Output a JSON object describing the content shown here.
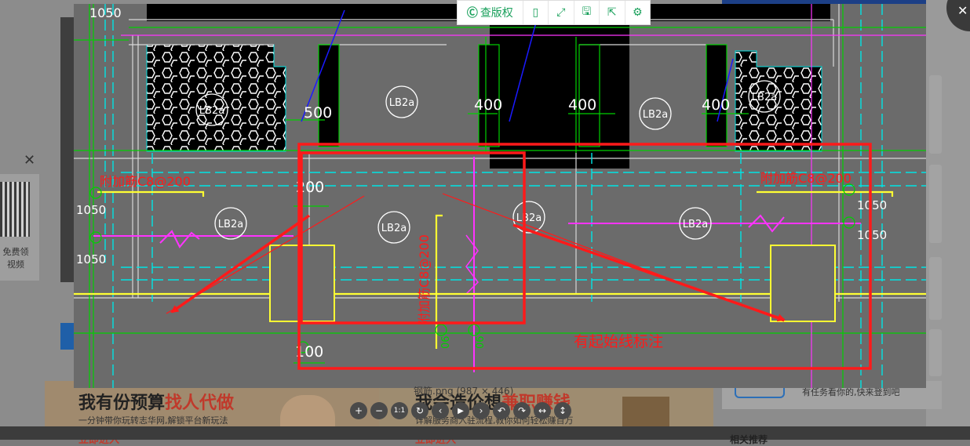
{
  "background": {
    "qr_text": "免费领视频",
    "ads": [
      {
        "title_plain": "我有份预算",
        "title_highlight": "找人代做",
        "subtitle": "一分钟带你玩转志华网,解锁平台新玩法",
        "link": "立即进入"
      },
      {
        "title_plain": "我会造价想",
        "title_highlight": "兼职赚钱",
        "subtitle": "详解服务商入驻流程,教你如何轻松赚百万",
        "link": "立即进入"
      }
    ],
    "right_under_text": "有任务看你的,快来登到吧",
    "right_bottom_title": "相关推荐"
  },
  "viewer": {
    "file_label": "钢筋.png (987 × 446)",
    "toolbar": {
      "copyright_label": "查版权",
      "icons": [
        "copyright-icon",
        "phone-icon",
        "fullscreen-icon",
        "save-icon",
        "share-icon",
        "settings-icon"
      ]
    },
    "controls": [
      {
        "name": "zoom-in",
        "glyph": "+"
      },
      {
        "name": "zoom-out",
        "glyph": "−"
      },
      {
        "name": "actual-size",
        "glyph": "1:1"
      },
      {
        "name": "rotate",
        "glyph": "↻"
      },
      {
        "name": "previous",
        "glyph": "‹"
      },
      {
        "name": "play",
        "glyph": "▶"
      },
      {
        "name": "next",
        "glyph": "›"
      },
      {
        "name": "undo",
        "glyph": "↶"
      },
      {
        "name": "redo",
        "glyph": "↷"
      },
      {
        "name": "flip-horizontal",
        "glyph": "↔"
      },
      {
        "name": "flip-vertical",
        "glyph": "↕"
      }
    ]
  },
  "drawing": {
    "dims": [
      "1050",
      "500",
      "400",
      "400",
      "400",
      "200",
      "1050",
      "1050",
      "1050",
      "1050",
      "100"
    ],
    "slab_label": "LB2a",
    "rebar_notes": [
      "附加筋C8@200",
      "附加筋C8@200",
      "附加筋C8@200"
    ],
    "annotation": "有起始线标注",
    "small_labels": [
      "06",
      "06"
    ],
    "colors": {
      "cyan": "#00e5e5",
      "green": "#00d000",
      "yellow": "#ffff33",
      "magenta": "#ff33ff",
      "red": "#ff1a1a",
      "blue": "#1a1aff"
    }
  }
}
